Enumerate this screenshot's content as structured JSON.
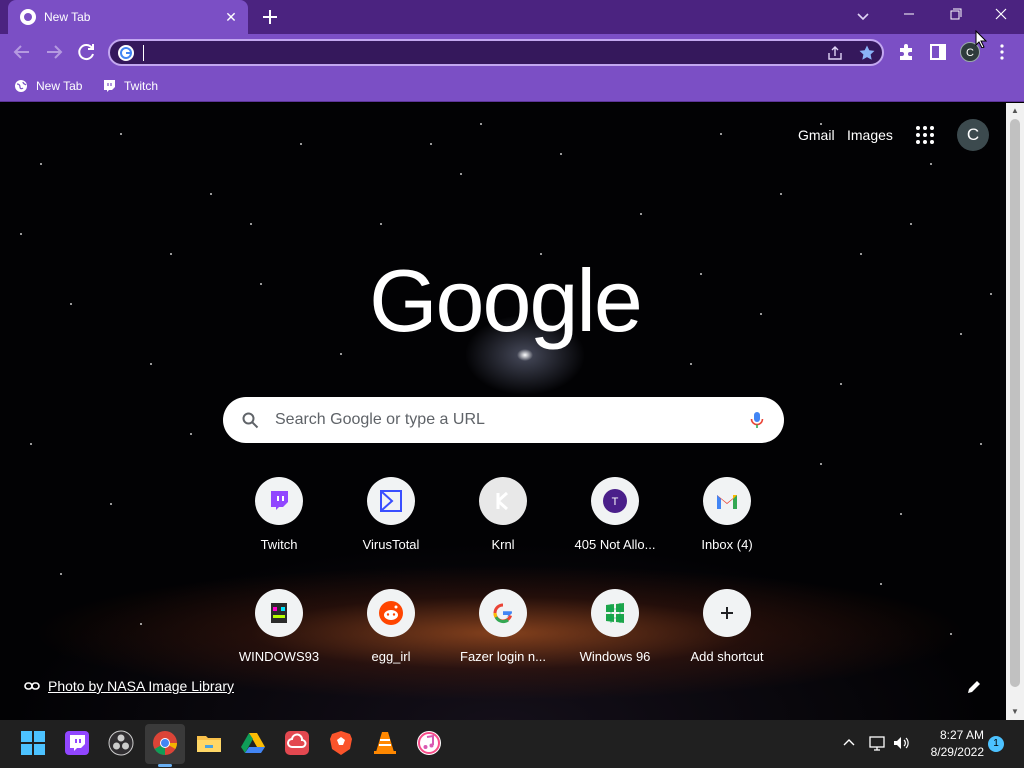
{
  "browser": {
    "tab": {
      "title": "New Tab",
      "favicon": "chrome-icon",
      "close_icon": "close-icon"
    },
    "new_tab_icon": "plus-icon",
    "tab_search_icon": "chevron-down-icon",
    "window_controls": [
      "minimize-icon",
      "restore-icon",
      "close-icon"
    ],
    "toolbar": {
      "back_icon": "arrow-left-icon",
      "forward_icon": "arrow-right-icon",
      "reload_icon": "reload-icon",
      "omnibox": {
        "value": "",
        "favicon": "google-g-icon",
        "share_icon": "share-icon",
        "bookmark_icon": "star-icon"
      },
      "extensions_icon": "puzzle-icon",
      "side_panel_icon": "side-panel-icon",
      "profile_initial": "C",
      "menu_icon": "kebab-menu-icon"
    },
    "bookmarks": [
      {
        "label": "New Tab",
        "icon": "globe-icon"
      },
      {
        "label": "Twitch",
        "icon": "twitch-icon"
      }
    ]
  },
  "newtab": {
    "top_links": {
      "gmail": "Gmail",
      "images": "Images"
    },
    "apps_icon": "apps-grid-icon",
    "account_initial": "C",
    "logo": "Google",
    "search": {
      "placeholder": "Search Google or type a URL",
      "icon": "search-icon",
      "mic_icon": "mic-icon"
    },
    "shortcuts": [
      {
        "label": "Twitch",
        "icon": "twitch-icon"
      },
      {
        "label": "VirusTotal",
        "icon": "virustotal-icon"
      },
      {
        "label": "Krnl",
        "icon": "krnl-icon"
      },
      {
        "label": "405 Not Allo...",
        "icon": "letter-t-icon",
        "letter": "T"
      },
      {
        "label": "Inbox (4)",
        "icon": "gmail-icon"
      },
      {
        "label": "WINDOWS93",
        "icon": "windows93-icon"
      },
      {
        "label": "egg_irl",
        "icon": "reddit-icon"
      },
      {
        "label": "Fazer login n...",
        "icon": "google-g-icon"
      },
      {
        "label": "Windows 96",
        "icon": "windows96-icon"
      },
      {
        "label": "Add shortcut",
        "icon": "plus-icon"
      }
    ],
    "credit": {
      "label": "Photo by NASA Image Library",
      "icon": "link-icon"
    },
    "customize_icon": "pencil-icon"
  },
  "taskbar": {
    "apps": [
      "windows-start-icon",
      "twitch-icon",
      "obs-icon",
      "chrome-icon",
      "file-explorer-icon",
      "google-drive-icon",
      "creative-cloud-icon",
      "brave-icon",
      "vlc-icon",
      "itunes-icon"
    ],
    "tray": [
      "chevron-up-icon",
      "network-icon",
      "volume-icon"
    ],
    "time": "8:27 AM",
    "date": "8/29/2022",
    "notification_count": "1"
  },
  "colors": {
    "frame": "#4b2380",
    "toolbar": "#7b4fc5",
    "omnibox": "#35185c",
    "twitch": "#9146ff",
    "accent": "#4cc2ff"
  }
}
